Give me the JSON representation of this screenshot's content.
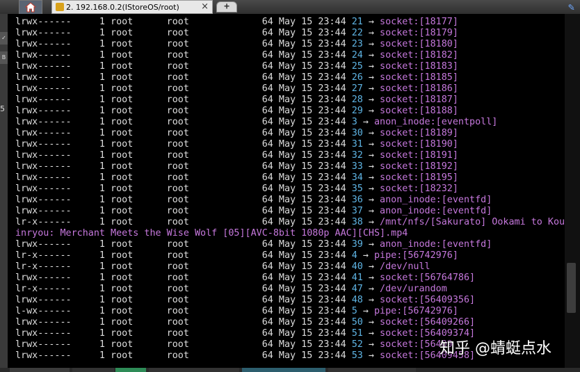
{
  "tabs": {
    "session_title": "2. 192.168.0.2(IStoreOS/root)",
    "close_label": "×",
    "new_tab_label": "+"
  },
  "left_strip": {
    "number": "5",
    "btn_a": "✓",
    "btn_b": "B"
  },
  "terminal": {
    "lines": [
      {
        "perm": "lrwx------",
        "links": "1",
        "owner": "root",
        "group": "root",
        "size": "64",
        "month": "May",
        "day": "15",
        "time": "23:44",
        "fd": "21",
        "arrow": "→",
        "target": "socket:[18177]"
      },
      {
        "perm": "lrwx------",
        "links": "1",
        "owner": "root",
        "group": "root",
        "size": "64",
        "month": "May",
        "day": "15",
        "time": "23:44",
        "fd": "22",
        "arrow": "→",
        "target": "socket:[18179]"
      },
      {
        "perm": "lrwx------",
        "links": "1",
        "owner": "root",
        "group": "root",
        "size": "64",
        "month": "May",
        "day": "15",
        "time": "23:44",
        "fd": "23",
        "arrow": "→",
        "target": "socket:[18180]"
      },
      {
        "perm": "lrwx------",
        "links": "1",
        "owner": "root",
        "group": "root",
        "size": "64",
        "month": "May",
        "day": "15",
        "time": "23:44",
        "fd": "24",
        "arrow": "→",
        "target": "socket:[18182]"
      },
      {
        "perm": "lrwx------",
        "links": "1",
        "owner": "root",
        "group": "root",
        "size": "64",
        "month": "May",
        "day": "15",
        "time": "23:44",
        "fd": "25",
        "arrow": "→",
        "target": "socket:[18183]"
      },
      {
        "perm": "lrwx------",
        "links": "1",
        "owner": "root",
        "group": "root",
        "size": "64",
        "month": "May",
        "day": "15",
        "time": "23:44",
        "fd": "26",
        "arrow": "→",
        "target": "socket:[18185]"
      },
      {
        "perm": "lrwx------",
        "links": "1",
        "owner": "root",
        "group": "root",
        "size": "64",
        "month": "May",
        "day": "15",
        "time": "23:44",
        "fd": "27",
        "arrow": "→",
        "target": "socket:[18186]"
      },
      {
        "perm": "lrwx------",
        "links": "1",
        "owner": "root",
        "group": "root",
        "size": "64",
        "month": "May",
        "day": "15",
        "time": "23:44",
        "fd": "28",
        "arrow": "→",
        "target": "socket:[18187]"
      },
      {
        "perm": "lrwx------",
        "links": "1",
        "owner": "root",
        "group": "root",
        "size": "64",
        "month": "May",
        "day": "15",
        "time": "23:44",
        "fd": "29",
        "arrow": "→",
        "target": "socket:[18188]"
      },
      {
        "perm": "lrwx------",
        "links": "1",
        "owner": "root",
        "group": "root",
        "size": "64",
        "month": "May",
        "day": "15",
        "time": "23:44",
        "fd": "3",
        "arrow": "→",
        "target": "anon_inode:[eventpoll]"
      },
      {
        "perm": "lrwx------",
        "links": "1",
        "owner": "root",
        "group": "root",
        "size": "64",
        "month": "May",
        "day": "15",
        "time": "23:44",
        "fd": "30",
        "arrow": "→",
        "target": "socket:[18189]"
      },
      {
        "perm": "lrwx------",
        "links": "1",
        "owner": "root",
        "group": "root",
        "size": "64",
        "month": "May",
        "day": "15",
        "time": "23:44",
        "fd": "31",
        "arrow": "→",
        "target": "socket:[18190]"
      },
      {
        "perm": "lrwx------",
        "links": "1",
        "owner": "root",
        "group": "root",
        "size": "64",
        "month": "May",
        "day": "15",
        "time": "23:44",
        "fd": "32",
        "arrow": "→",
        "target": "socket:[18191]"
      },
      {
        "perm": "lrwx------",
        "links": "1",
        "owner": "root",
        "group": "root",
        "size": "64",
        "month": "May",
        "day": "15",
        "time": "23:44",
        "fd": "33",
        "arrow": "→",
        "target": "socket:[18192]"
      },
      {
        "perm": "lrwx------",
        "links": "1",
        "owner": "root",
        "group": "root",
        "size": "64",
        "month": "May",
        "day": "15",
        "time": "23:44",
        "fd": "34",
        "arrow": "→",
        "target": "socket:[18195]"
      },
      {
        "perm": "lrwx------",
        "links": "1",
        "owner": "root",
        "group": "root",
        "size": "64",
        "month": "May",
        "day": "15",
        "time": "23:44",
        "fd": "35",
        "arrow": "→",
        "target": "socket:[18232]"
      },
      {
        "perm": "lrwx------",
        "links": "1",
        "owner": "root",
        "group": "root",
        "size": "64",
        "month": "May",
        "day": "15",
        "time": "23:44",
        "fd": "36",
        "arrow": "→",
        "target": "anon_inode:[eventfd]"
      },
      {
        "perm": "lrwx------",
        "links": "1",
        "owner": "root",
        "group": "root",
        "size": "64",
        "month": "May",
        "day": "15",
        "time": "23:44",
        "fd": "37",
        "arrow": "→",
        "target": "anon_inode:[eventfd]"
      },
      {
        "perm": "lr-x------",
        "links": "1",
        "owner": "root",
        "group": "root",
        "size": "64",
        "month": "May",
        "day": "15",
        "time": "23:44",
        "fd": "38",
        "arrow": "→",
        "target": "/mnt/nfs/[Sakurato] Ookami to Koush"
      },
      {
        "wrap": "inryou: Merchant Meets the Wise Wolf [05][AVC-8bit 1080p AAC][CHS].mp4"
      },
      {
        "perm": "lrwx------",
        "links": "1",
        "owner": "root",
        "group": "root",
        "size": "64",
        "month": "May",
        "day": "15",
        "time": "23:44",
        "fd": "39",
        "arrow": "→",
        "target": "anon_inode:[eventfd]"
      },
      {
        "perm": "lr-x------",
        "links": "1",
        "owner": "root",
        "group": "root",
        "size": "64",
        "month": "May",
        "day": "15",
        "time": "23:44",
        "fd": "4",
        "arrow": "→",
        "target": "pipe:[56742976]"
      },
      {
        "perm": "lr-x------",
        "links": "1",
        "owner": "root",
        "group": "root",
        "size": "64",
        "month": "May",
        "day": "15",
        "time": "23:44",
        "fd": "40",
        "arrow": "→",
        "target": "/dev/null"
      },
      {
        "perm": "lrwx------",
        "links": "1",
        "owner": "root",
        "group": "root",
        "size": "64",
        "month": "May",
        "day": "15",
        "time": "23:44",
        "fd": "41",
        "arrow": "→",
        "target": "socket:[56764786]"
      },
      {
        "perm": "lr-x------",
        "links": "1",
        "owner": "root",
        "group": "root",
        "size": "64",
        "month": "May",
        "day": "15",
        "time": "23:44",
        "fd": "47",
        "arrow": "→",
        "target": "/dev/urandom"
      },
      {
        "perm": "lrwx------",
        "links": "1",
        "owner": "root",
        "group": "root",
        "size": "64",
        "month": "May",
        "day": "15",
        "time": "23:44",
        "fd": "48",
        "arrow": "→",
        "target": "socket:[56409356]"
      },
      {
        "perm": "l-wx------",
        "links": "1",
        "owner": "root",
        "group": "root",
        "size": "64",
        "month": "May",
        "day": "15",
        "time": "23:44",
        "fd": "5",
        "arrow": "→",
        "target": "pipe:[56742976]"
      },
      {
        "perm": "lrwx------",
        "links": "1",
        "owner": "root",
        "group": "root",
        "size": "64",
        "month": "May",
        "day": "15",
        "time": "23:44",
        "fd": "50",
        "arrow": "→",
        "target": "socket:[56409266]"
      },
      {
        "perm": "lrwx------",
        "links": "1",
        "owner": "root",
        "group": "root",
        "size": "64",
        "month": "May",
        "day": "15",
        "time": "23:44",
        "fd": "51",
        "arrow": "→",
        "target": "socket:[56409374]"
      },
      {
        "perm": "lrwx------",
        "links": "1",
        "owner": "root",
        "group": "root",
        "size": "64",
        "month": "May",
        "day": "15",
        "time": "23:44",
        "fd": "52",
        "arrow": "→",
        "target": "socket:[56409"
      },
      {
        "perm": "lrwx------",
        "links": "1",
        "owner": "root",
        "group": "root",
        "size": "64",
        "month": "May",
        "day": "15",
        "time": "23:44",
        "fd": "53",
        "arrow": "→",
        "target": "socket:[56409458]"
      }
    ]
  },
  "watermark": "知乎 @蜻蜓点水",
  "colors": {
    "fd": "#5fb5e5",
    "target": "#c678dd",
    "text": "#dddddd",
    "background": "#000000"
  }
}
